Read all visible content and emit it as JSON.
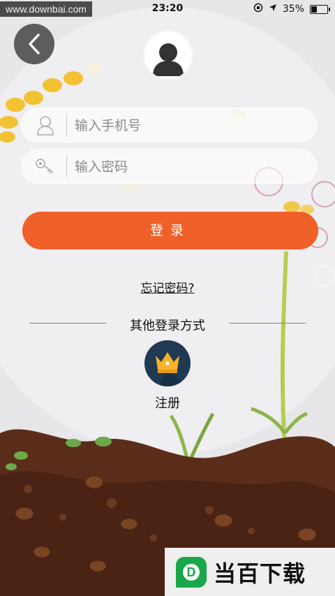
{
  "status_bar": {
    "watermark": "www.downbai.com",
    "time": "23:20",
    "battery_percent_label": "35%",
    "battery_level": 0.35
  },
  "form": {
    "phone_placeholder": "输入手机号",
    "password_placeholder": "输入密码",
    "login_label": "登录",
    "forgot_label": "忘记密码?"
  },
  "other_login": {
    "title": "其他登录方式",
    "register_label": "注册"
  },
  "brand": {
    "text": "当百下载",
    "logo_letter": "D"
  },
  "colors": {
    "accent": "#f06029",
    "register_circle": "#1f3a52",
    "crown": "#f5b22a",
    "brand_green": "#18a84a"
  }
}
